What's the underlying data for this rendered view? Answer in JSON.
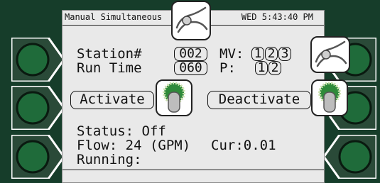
{
  "titlebar": {
    "screen_title": "Manual Simultaneous",
    "datetime": "WED 5:43:40 PM"
  },
  "station": {
    "label": "Station#",
    "value": "002"
  },
  "runtime": {
    "label": "Run Time",
    "value": "060"
  },
  "mv": {
    "label": "MV:",
    "options": [
      "1",
      "2",
      "3"
    ]
  },
  "pump": {
    "label": "P:",
    "options": [
      "1",
      "2"
    ]
  },
  "actions": {
    "activate_label": "Activate",
    "deactivate_label": "Deactivate"
  },
  "status": {
    "status_text": "Status: Off",
    "flow_text": "Flow: 24 (GPM)",
    "current_text": "Cur:0.01",
    "running_text": "Running:"
  },
  "colors": {
    "bezel": "#163d2a",
    "screen": "#e9e9e9",
    "key_green": "#1f6b3a",
    "key_ring": "#ffffff"
  }
}
